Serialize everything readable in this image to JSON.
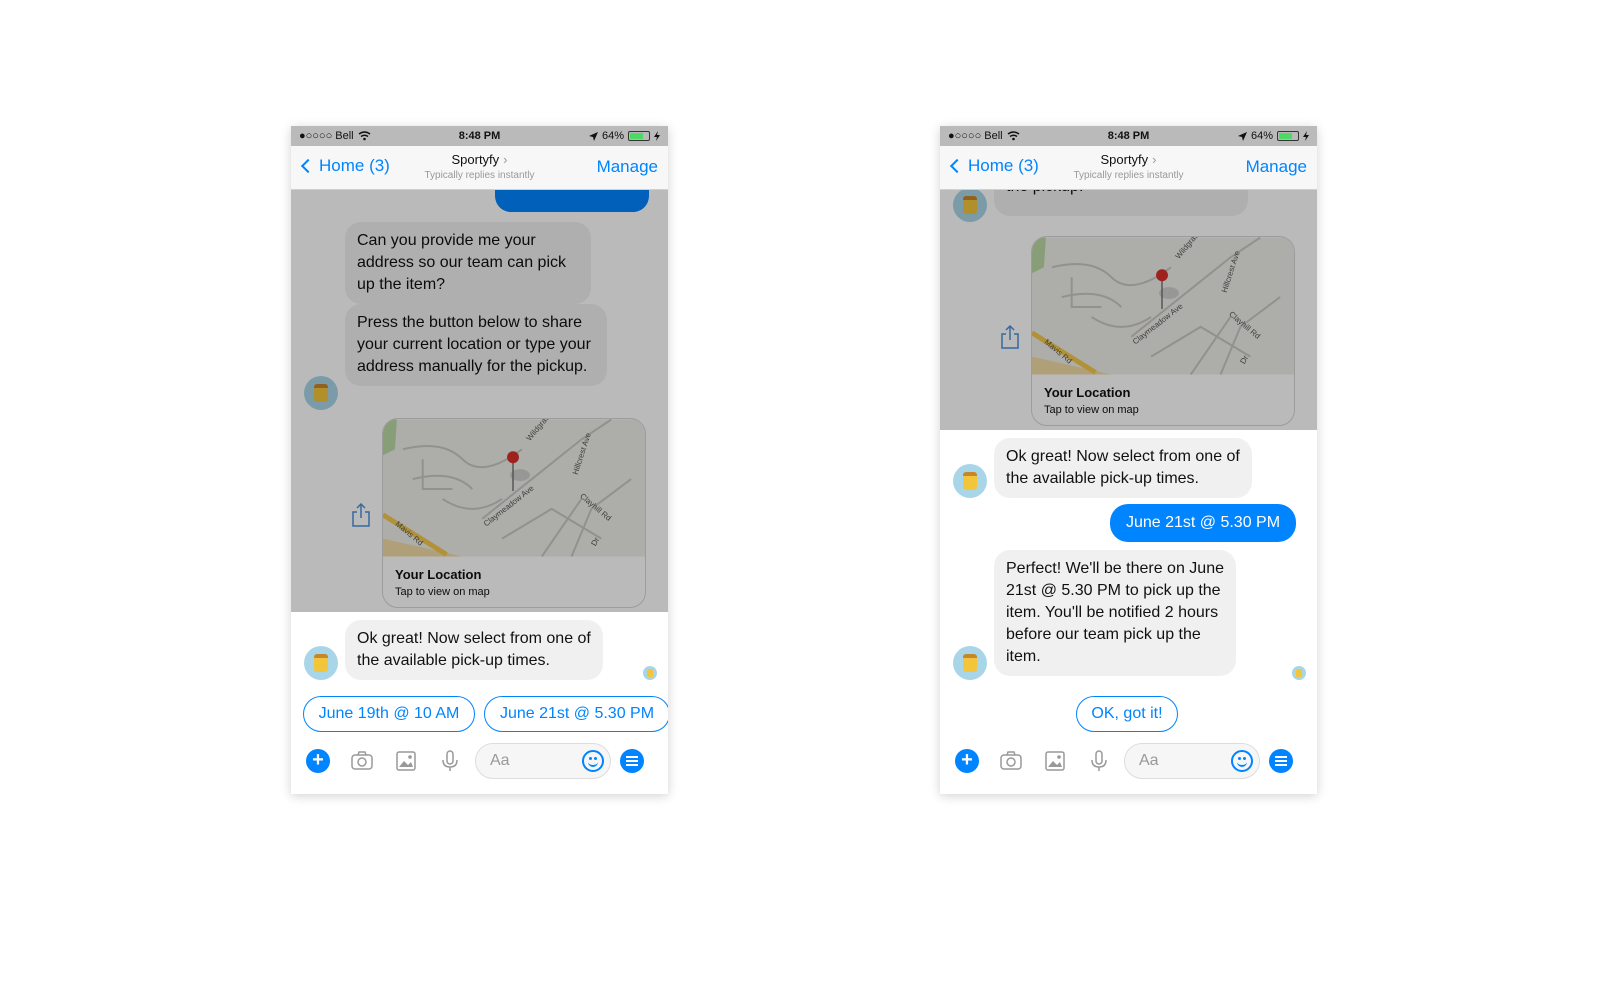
{
  "status_bar": {
    "carrier": "●○○○○ Bell",
    "time": "8:48 PM",
    "battery": "64%"
  },
  "nav": {
    "back_label": "Home (3)",
    "title": "Sportyfy",
    "subtitle": "Typically replies instantly",
    "manage_label": "Manage"
  },
  "messages": {
    "address_request": "Can you provide me your address so our team can pick up the item?",
    "press_button": "Press the button below to share your current location or type your address manually for the pickup.",
    "press_button_tail_1": "type your address manually for",
    "press_button_tail_2": "the pickup.",
    "select_time": "Ok great! Now select from one of the available pick-up times.",
    "user_choice": "June 21st @ 5.30 PM",
    "confirmation": "Perfect! We'll be there on June 21st @ 5.30 PM to pick up the item. You'll be notified 2 hours before our team pick up the item."
  },
  "location_card": {
    "title": "Your Location",
    "subtitle": "Tap to view on map",
    "streets": [
      "Mavis Rd",
      "Claymeadow Ave",
      "Wildgras",
      "Hillcrest Ave",
      "Clayhill Rd",
      "Dr"
    ]
  },
  "quick_replies_left": [
    "June 19th @ 10 AM",
    "June 21st @ 5.30 PM"
  ],
  "quick_reply_right": "OK, got it!",
  "composer": {
    "placeholder": "Aa"
  },
  "icons": [
    "plus-icon",
    "camera-icon",
    "image-icon",
    "microphone-icon",
    "emoji-icon",
    "menu-icon",
    "share-icon",
    "wifi-icon",
    "location-arrow-icon",
    "battery-icon",
    "chevron-left-icon"
  ],
  "colors": {
    "accent": "#0084ff",
    "bubble_gray": "#f1f0f0",
    "avatar_bg": "#a9d5e8"
  }
}
